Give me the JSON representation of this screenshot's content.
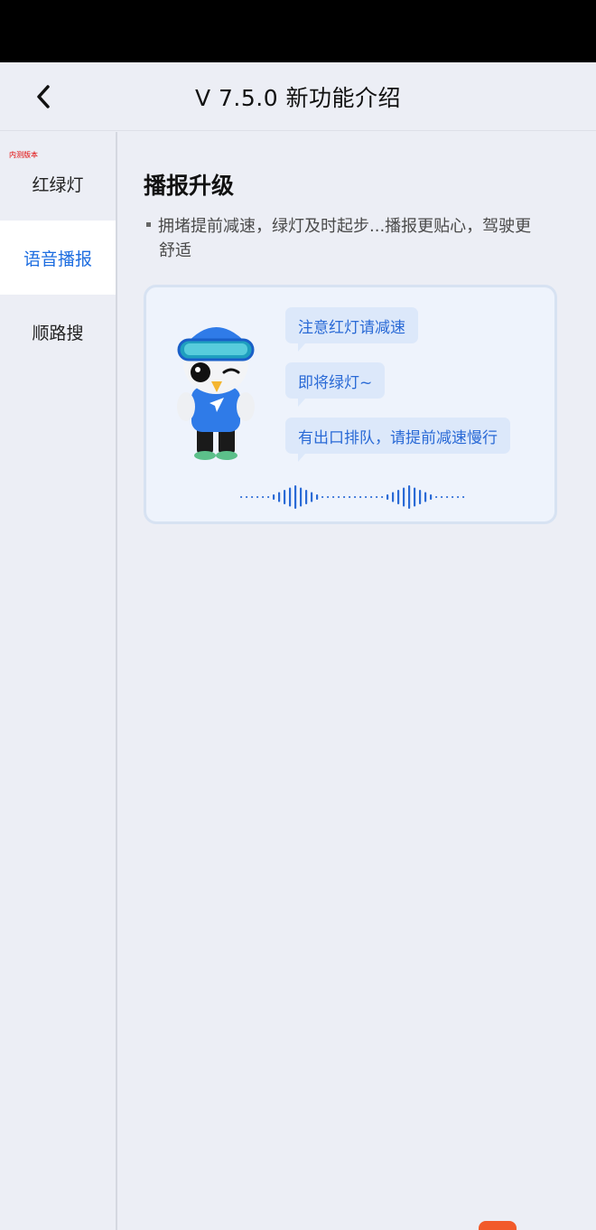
{
  "header": {
    "title": "V 7.5.0 新功能介绍",
    "back_icon": "chevron-left-icon"
  },
  "sidebar": {
    "badge": "内测版本",
    "items": [
      {
        "label": "红绿灯",
        "active": false
      },
      {
        "label": "语音播报",
        "active": true
      },
      {
        "label": "顺路搜",
        "active": false
      }
    ]
  },
  "main": {
    "section_title": "播报升级",
    "description_line1": "拥堵提前减速，绿灯及时起步...播报更贴心，驾驶更",
    "description_line2": "舒适",
    "bubbles": [
      "注意红灯请减速",
      "即将绿灯~",
      "有出口排队，请提前减速慢行"
    ]
  },
  "colors": {
    "accent": "#1d6de0",
    "bubble_bg": "#dce8fa",
    "bubble_text": "#2a6ad6",
    "page_bg": "#eceef5",
    "badge": "#e00000"
  }
}
